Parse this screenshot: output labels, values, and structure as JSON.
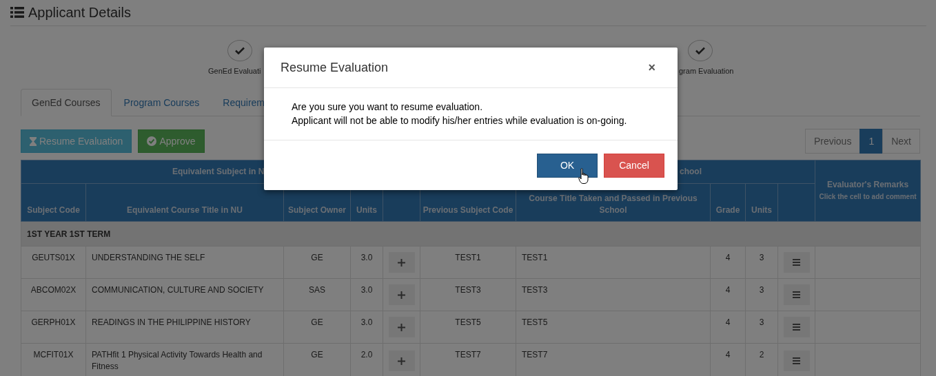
{
  "page": {
    "title": "Applicant Details"
  },
  "steps": [
    {
      "label": "GenEd Evaluati",
      "done": true
    },
    {
      "label": "gram Evaluation",
      "done": true
    }
  ],
  "tabs": [
    {
      "label": "GenEd Courses",
      "selected": true
    },
    {
      "label": "Program Courses",
      "selected": false
    },
    {
      "label": "Requirem",
      "selected": false
    }
  ],
  "actions": [
    {
      "kind": "resume",
      "label": "Resume Evaluation"
    },
    {
      "kind": "approve",
      "label": "Approve"
    }
  ],
  "pagination": [
    {
      "label": "Previous",
      "selected": false
    },
    {
      "label": "1",
      "selected": true
    },
    {
      "label": "Next",
      "selected": false
    }
  ],
  "table": {
    "group_headers": [
      "Equivalent Subject in N",
      "chool"
    ],
    "remarks_header": {
      "title": "Evaluator's Remarks",
      "hint": "Click the cell to add comment"
    },
    "columns": [
      "Subject Code",
      "Equivalent Course Title in NU",
      "Subject Owner",
      "Units",
      "Previous Subject Code",
      "Course Title Taken and Passed in Previous School",
      "Grade",
      "Units"
    ],
    "sections": [
      {
        "term": "1ST YEAR 1ST TERM",
        "rows": [
          {
            "code": "GEUTS01X",
            "title": "UNDERSTANDING THE SELF",
            "owner": "GE",
            "units": "3.0",
            "prev_code": "TEST1",
            "prev_title": "TEST1",
            "grade": "4",
            "prev_units": "3"
          },
          {
            "code": "ABCOM02X",
            "title": "COMMUNICATION, CULTURE AND SOCIETY",
            "owner": "SAS",
            "units": "3.0",
            "prev_code": "TEST3",
            "prev_title": "TEST3",
            "grade": "4",
            "prev_units": "3"
          },
          {
            "code": "GERPH01X",
            "title": "READINGS IN THE PHILIPPINE HISTORY",
            "owner": "GE",
            "units": "3.0",
            "prev_code": "TEST5",
            "prev_title": "TEST5",
            "grade": "4",
            "prev_units": "3"
          },
          {
            "code": "MCFIT01X",
            "title": "PATHfit 1 Physical Activity Towards Health and Fitness",
            "owner": "GE",
            "units": "2.0",
            "prev_code": "TEST7",
            "prev_title": "TEST7",
            "grade": "4",
            "prev_units": "2"
          }
        ]
      }
    ]
  },
  "dialog": {
    "title": "Resume Evaluation",
    "close": "×",
    "lines": [
      "Are you sure you want to resume evaluation.",
      "Applicant will not be able to modify his/her entries while evaluation is on-going."
    ],
    "buttons": [
      {
        "kind": "primary",
        "label": "OK"
      },
      {
        "kind": "danger",
        "label": "Cancel"
      }
    ]
  }
}
